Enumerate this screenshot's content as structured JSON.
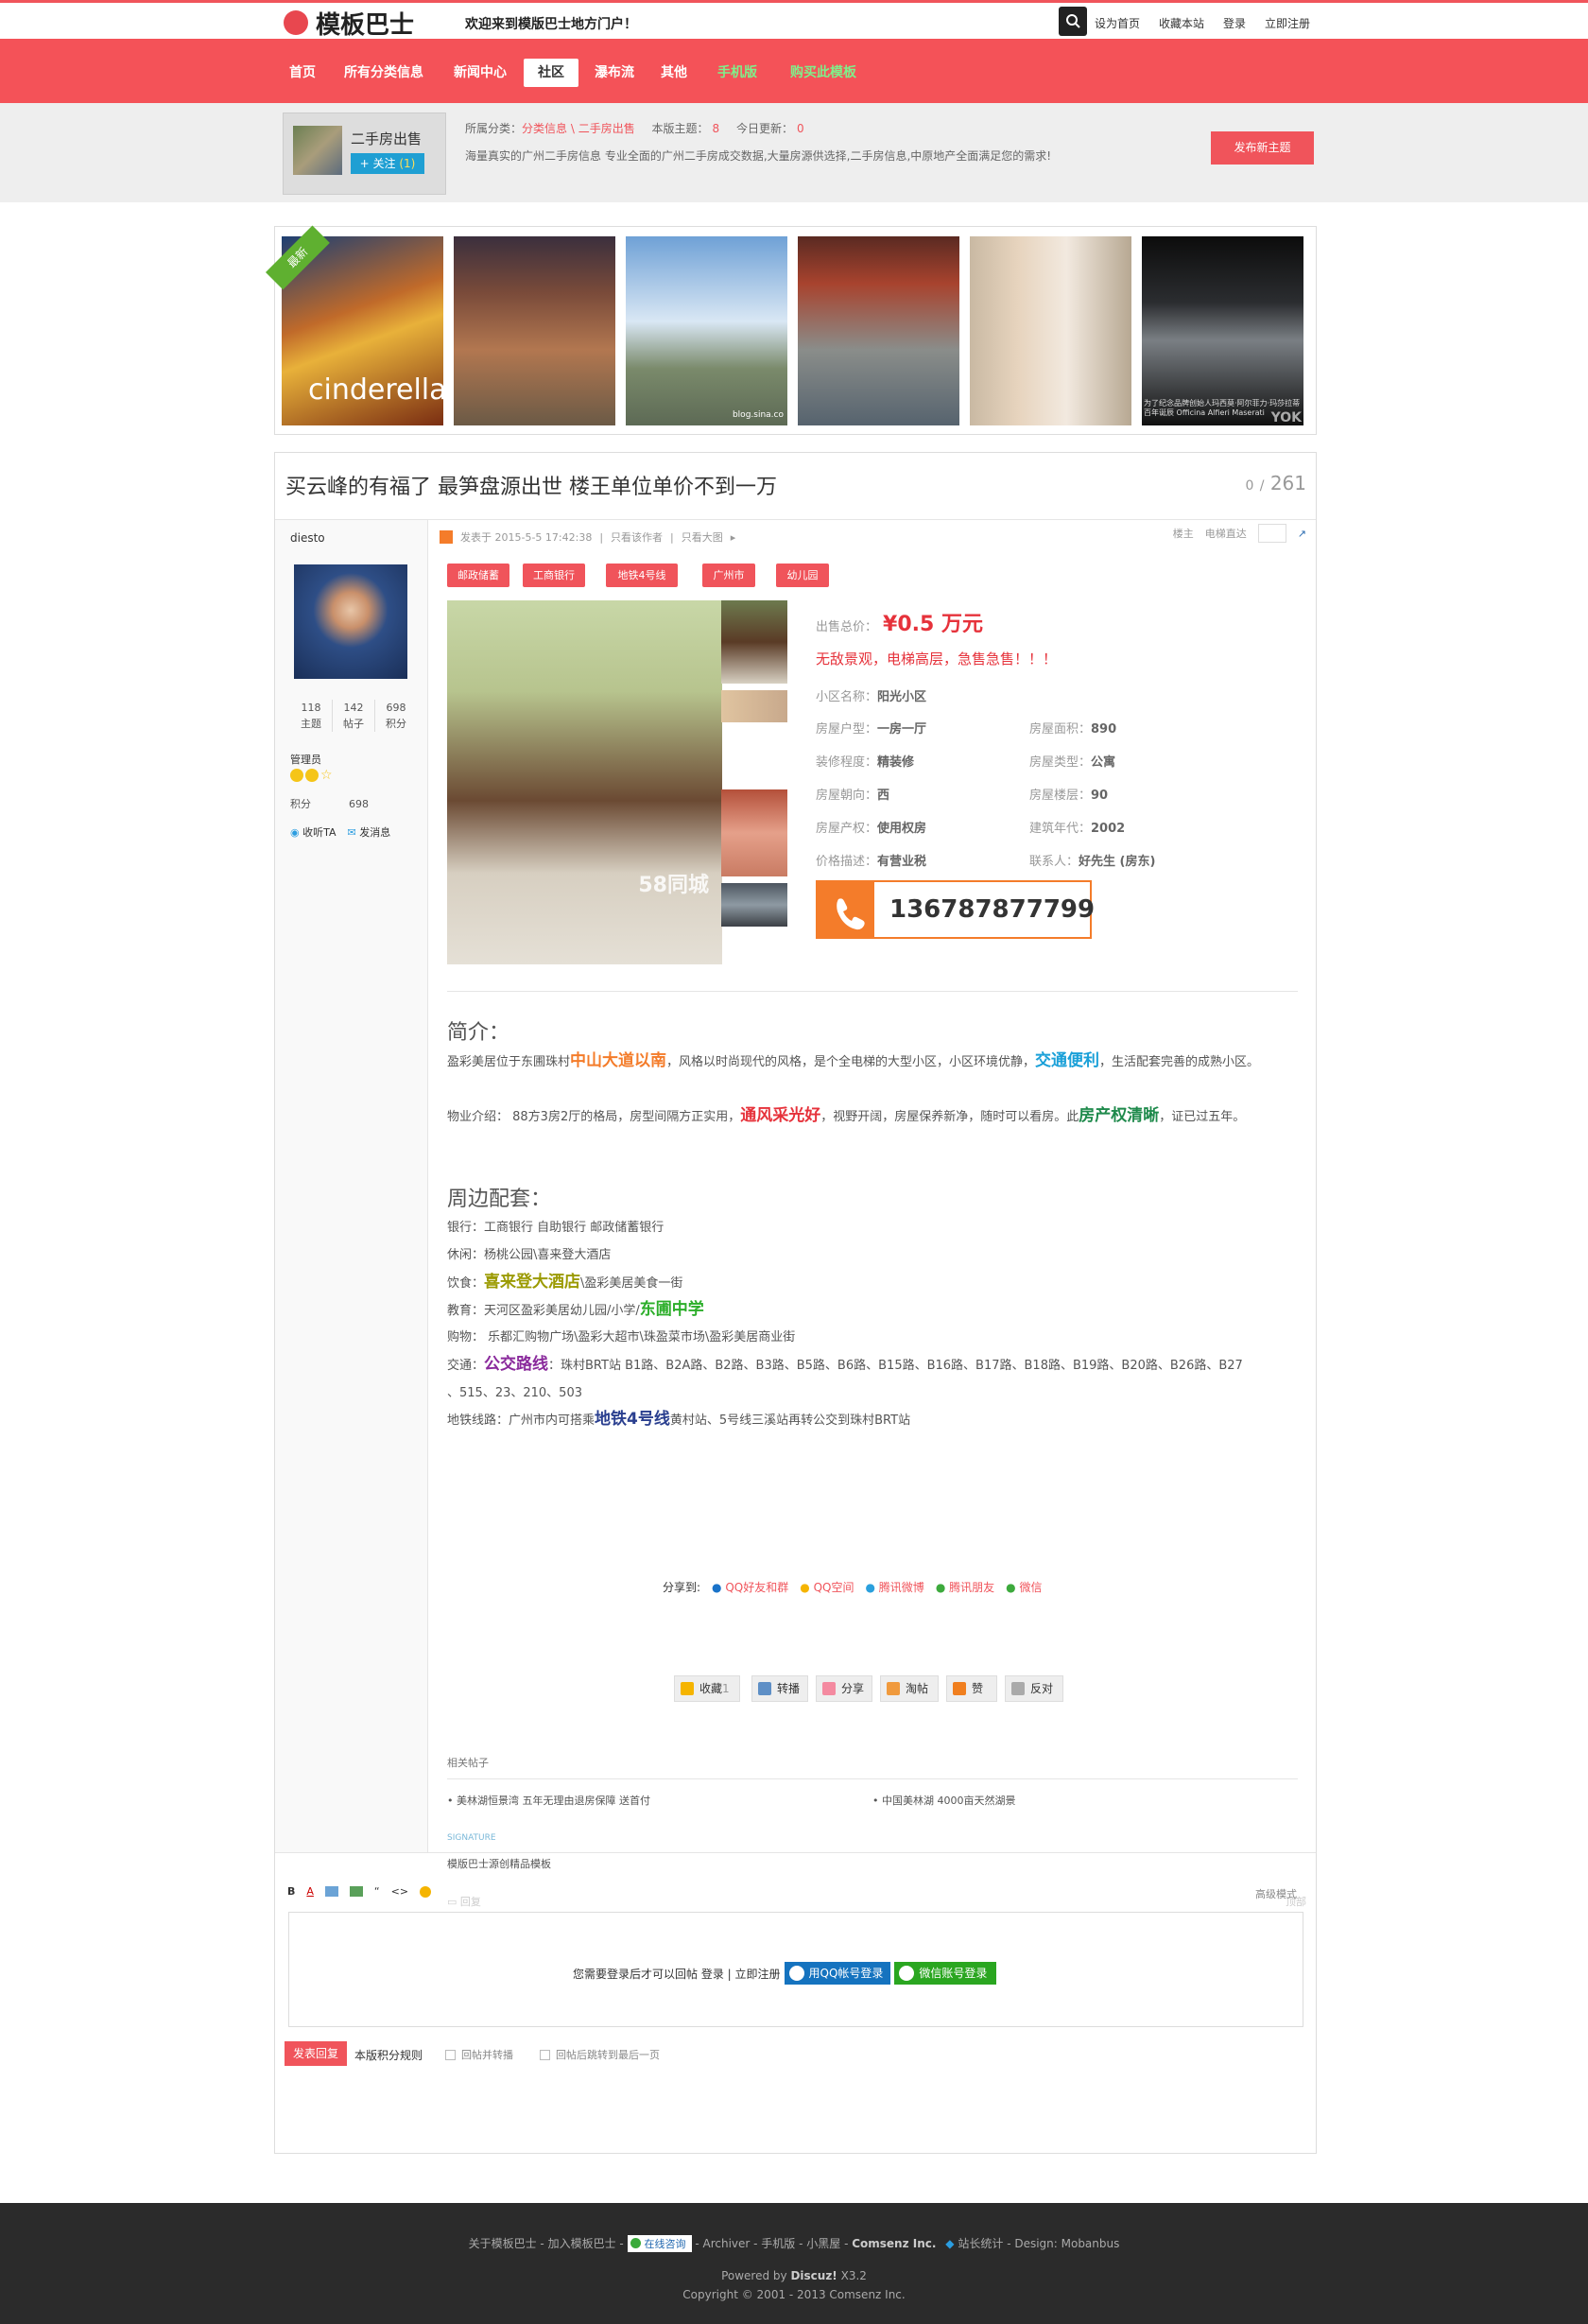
{
  "header": {
    "logo_text": "模板巴士",
    "welcome": "欢迎来到模版巴士地方门户！",
    "links": [
      "设为首页",
      "收藏本站",
      "登录",
      "立即注册"
    ]
  },
  "nav": {
    "items": [
      "首页",
      "所有分类信息",
      "新闻中心",
      "社区",
      "瀑布流",
      "其他",
      "手机版",
      "购买此模板"
    ],
    "active_index": 3
  },
  "forum": {
    "title": "二手房出售",
    "follow": "+ 关注",
    "follow_count": "(1)",
    "breadcrumb_label": "所属分类：",
    "breadcrumb": "分类信息 \\ 二手房出售",
    "today_posts_label": "本版主题：",
    "today_posts": "8",
    "updates_label": "今日更新：",
    "updates": "0",
    "description": "海量真实的广州二手房信息 专业全面的广州二手房成交数据,大量房源供选择,二手房信息,中原地产全面满足您的需求!",
    "post_button": "发布新主题"
  },
  "gallery": {
    "ribbon": "最新",
    "images": [
      "cinderella-poster",
      "brick-building",
      "skyline",
      "lantern-street",
      "brochure",
      "sports-car"
    ],
    "caption_1": "cinderella",
    "caption_3": "blog.sina.co",
    "caption_6": "为了纪念品牌创始人玛西莫·阿尔菲力·玛莎拉蒂百年诞辰 Officina Alfieri Maserati",
    "caption_6b": "YOK"
  },
  "post": {
    "title": "买云峰的有福了 最笋盘源出世 楼王单位单价不到一万",
    "replies": "0",
    "separator": "/",
    "views": "261",
    "author": "diesto",
    "stats": [
      {
        "n": "118",
        "l": "主题"
      },
      {
        "n": "142",
        "l": "帖子"
      },
      {
        "n": "698",
        "l": "积分"
      }
    ],
    "role": "管理员",
    "points_label": "积分",
    "points": "698",
    "listen": "收听TA",
    "message": "发消息",
    "meta": "发表于 2015-5-5 17:42:38",
    "only_author": "只看该作者",
    "only_big": "只看大图",
    "floor": "楼主",
    "go_floor": "电梯直达",
    "tags": [
      "邮政储蓄",
      "工商银行",
      "地铁4号线",
      "广州市",
      "幼儿园"
    ],
    "price_label": "出售总价：",
    "price": "¥0.5 万元",
    "headline": "无敌景观，电梯高层，急售急售！！！",
    "community_label": "小区名称：",
    "community": "阳光小区",
    "fields": [
      {
        "l": "房屋户型：",
        "v": "一房一厅",
        "l2": "房屋面积：",
        "v2": "890"
      },
      {
        "l": "装修程度：",
        "v": "精装修",
        "l2": "房屋类型：",
        "v2": "公寓"
      },
      {
        "l": "房屋朝向：",
        "v": "西",
        "l2": "房屋楼层：",
        "v2": "90"
      },
      {
        "l": "房屋产权：",
        "v": "使用权房",
        "l2": "建筑年代：",
        "v2": "2002"
      },
      {
        "l": "价格描述：",
        "v": "有营业税",
        "l2": "联系人：",
        "v2": "好先生 (房东)"
      }
    ],
    "phone": "136787877799",
    "watermark": "58同城"
  },
  "intro": {
    "title": "简介：",
    "p1_a": "盈彩美居位于东圃珠村",
    "p1_b": "中山大道以南",
    "p1_c": "，风格以时尚现代的风格，是个全电梯的大型小区，小区环境优静，",
    "p1_d": "交通便利",
    "p1_e": "，生活配套完善的成熟小区。",
    "p2_a": "物业介绍： 88方3房2厅的格局，房型间隔方正实用，",
    "p2_b": "通风采光好",
    "p2_c": "，视野开阔，房屋保养新净，随时可以看房。此",
    "p2_d": "房产权清晰",
    "p2_e": "，证已过五年。"
  },
  "nearby": {
    "title": "周边配套：",
    "bank": "银行：工商银行 自助银行 邮政储蓄银行",
    "leisure": "休闲：杨桃公园\\喜来登大酒店",
    "food_a": "饮食：",
    "food_b": "喜来登大酒店",
    "food_c": "\\盈彩美居美食一街",
    "edu_a": "教育：天河区盈彩美居幼儿园/小学/",
    "edu_b": "东圃中学",
    "shop": "购物： 乐都汇购物广场\\盈彩大超市\\珠盈菜市场\\盈彩美居商业街",
    "traffic_a": "交通：",
    "traffic_b": "公交路线",
    "traffic_c": "：珠村BRT站 B1路、B2A路、B2路、B3路、B5路、B6路、B15路、B16路、B17路、B18路、B19路、B20路、B26路、B27",
    "traffic_d": "、515、23、210、503",
    "metro_a": "地铁线路：广州市内可搭乘",
    "metro_b": "地铁4号线",
    "metro_c": "黄村站、5号线三溪站再转公交到珠村BRT站"
  },
  "share": {
    "label": "分享到:",
    "items": [
      "QQ好友和群",
      "QQ空间",
      "腾讯微博",
      "腾讯朋友",
      "微信"
    ],
    "actions": [
      "收藏",
      "转播",
      "分享",
      "淘帖",
      "赞",
      "反对"
    ],
    "fav_count": "1"
  },
  "related": {
    "title": "相关帖子",
    "items": [
      "美林湖恒景湾 五年无理由退房保障 送首付",
      "中国美林湖 4000亩天然湖景"
    ],
    "signature_label": "SIGNATURE",
    "signature": "模版巴士源创精品模板",
    "reply": "回复",
    "top": "顶部"
  },
  "reply": {
    "advanced": "高级模式",
    "login_notice": "您需要登录后才可以回帖 登录 | 立即注册",
    "qq_login": "用QQ帐号登录",
    "wechat_login": "微信账号登录",
    "submit": "发表回复",
    "rules": "本版积分规则",
    "opt1": "回帖并转播",
    "opt2": "回帖后跳转到最后一页"
  },
  "footer": {
    "links_a": "关于模板巴士 - 加入模板巴士 - ",
    "online": "在线咨询",
    "links_b": " - Archiver - 手机版 - 小黑屋 - ",
    "company": "Comsenz Inc.",
    "stats": "站长统计",
    "design": " - Design: Mobanbus",
    "powered_a": "Powered by ",
    "powered_b": "Discuz!",
    "powered_c": " X3.2",
    "copyright": "Copyright © 2001 - 2013 Comsenz Inc."
  }
}
